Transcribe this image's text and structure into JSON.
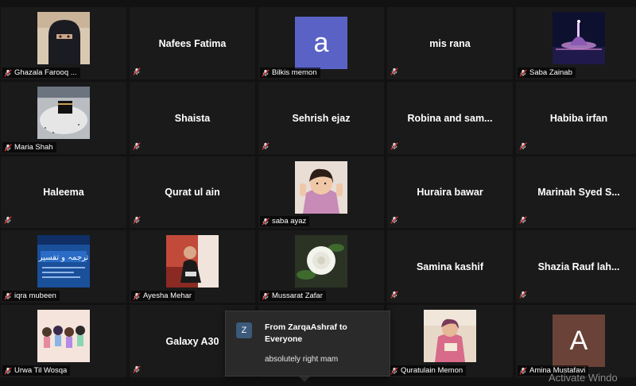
{
  "participants": [
    {
      "name": "Ghazala Farooq ...",
      "display": "photo",
      "photo": "niqab"
    },
    {
      "name": "Nafees Fatima",
      "display": "name"
    },
    {
      "name": "Bilkis memon",
      "display": "letter",
      "letter": "a",
      "color": "#5a63c5"
    },
    {
      "name": "mis rana",
      "display": "name"
    },
    {
      "name": "Saba Zainab",
      "display": "photo",
      "photo": "mosque-night"
    },
    {
      "name": "Maria Shah",
      "display": "photo",
      "photo": "kaaba"
    },
    {
      "name": "Shaista",
      "display": "name"
    },
    {
      "name": "Sehrish ejaz",
      "display": "name"
    },
    {
      "name": "Robina and sam...",
      "display": "name"
    },
    {
      "name": "Habiba irfan",
      "display": "name"
    },
    {
      "name": "Haleema",
      "display": "name"
    },
    {
      "name": "Qurat ul ain",
      "display": "name"
    },
    {
      "name": "saba ayaz",
      "display": "photo",
      "photo": "child"
    },
    {
      "name": "Huraira bawar",
      "display": "name"
    },
    {
      "name": "Marinah  Syed  S...",
      "display": "name"
    },
    {
      "name": "iqra mubeen",
      "display": "photo",
      "photo": "urdu-banner"
    },
    {
      "name": "Ayesha Mehar",
      "display": "photo",
      "photo": "person-red"
    },
    {
      "name": "Mussarat Zafar",
      "display": "photo",
      "photo": "white-rose"
    },
    {
      "name": "Samina kashif",
      "display": "name"
    },
    {
      "name": "Shazia  Rauf  lah...",
      "display": "name"
    },
    {
      "name": "Urwa Til Wosqa",
      "display": "photo",
      "photo": "cartoon-girls"
    },
    {
      "name": "Galaxy A30",
      "display": "name"
    },
    {
      "name": "",
      "display": "hidden"
    },
    {
      "name": "Quratulain Memon",
      "display": "photo",
      "photo": "woman-pink"
    },
    {
      "name": "Amina Mustafavi",
      "display": "letter",
      "letter": "A",
      "color": "#6b4238"
    }
  ],
  "chat": {
    "avatar_letter": "Z",
    "from": "From ZarqaAshraf to Everyone",
    "message": "absolutely right mam"
  },
  "watermark": "Activate Windo",
  "icons": {
    "muted": "mic-muted-icon"
  }
}
